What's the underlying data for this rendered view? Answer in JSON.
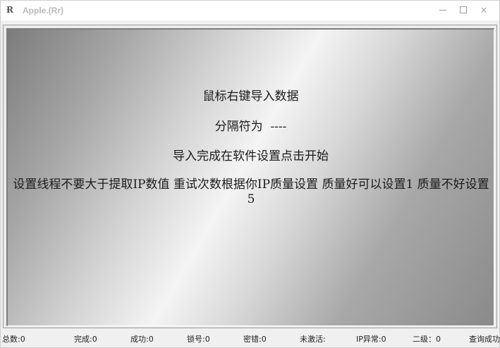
{
  "window": {
    "title": "Apple.(Rr)",
    "icon": "R-app-icon",
    "controls": {
      "minimize": "minimize-icon",
      "maximize": "maximize-icon",
      "close": "×"
    }
  },
  "panel": {
    "line1": "鼠标右键导入数据",
    "line2": "分隔符为  ----",
    "line3": "导入完成在软件设置点击开始",
    "line4": "设置线程不要大于提取IP数值  重试次数根据你IP质量设置 质量好可以设置1 质量不好设置5",
    "gradient_colors": [
      "#7c7c7c",
      "#f4f4f4",
      "#8a8a8a"
    ]
  },
  "status": {
    "total": "总数:0",
    "done": "完成:0",
    "success": "成功:0",
    "locked": "锁号:0",
    "wrong_password": "密错:0",
    "inactive": "未激活:",
    "ip_error": "IP异常:0",
    "level2": "二级：0",
    "query_success": "查询成功"
  }
}
